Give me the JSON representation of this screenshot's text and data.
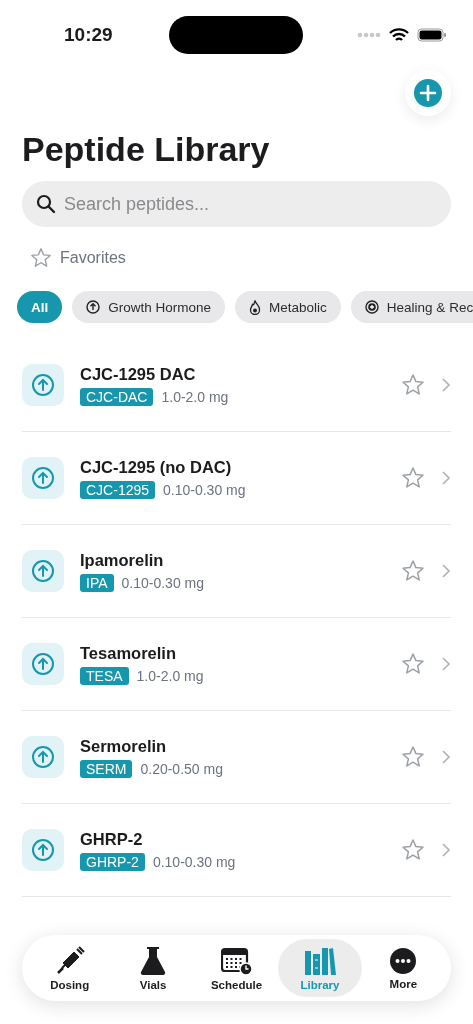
{
  "status_bar": {
    "time": "10:29"
  },
  "title": "Peptide Library",
  "search": {
    "placeholder": "Search peptides..."
  },
  "favorites": {
    "label": "Favorites",
    "selected": false
  },
  "filters": [
    {
      "label": "All",
      "kind": "plain",
      "selected": true
    },
    {
      "label": "Growth Hormone",
      "kind": "arrow",
      "selected": false
    },
    {
      "label": "Metabolic",
      "kind": "flame",
      "selected": false
    },
    {
      "label": "Healing & Rec",
      "kind": "plus",
      "selected": false
    }
  ],
  "peptides": [
    {
      "name": "CJC-1295 DAC",
      "code": "CJC-DAC",
      "dose": "1.0-2.0 mg",
      "favorite": false
    },
    {
      "name": "CJC-1295 (no DAC)",
      "code": "CJC-1295",
      "dose": "0.10-0.30 mg",
      "favorite": false
    },
    {
      "name": "Ipamorelin",
      "code": "IPA",
      "dose": "0.10-0.30 mg",
      "favorite": false
    },
    {
      "name": "Tesamorelin",
      "code": "TESA",
      "dose": "1.0-2.0 mg",
      "favorite": false
    },
    {
      "name": "Sermorelin",
      "code": "SERM",
      "dose": "0.20-0.50 mg",
      "favorite": false
    },
    {
      "name": "GHRP-2",
      "code": "GHRP-2",
      "dose": "0.10-0.30 mg",
      "favorite": false
    }
  ],
  "tabs": [
    {
      "label": "Dosing",
      "kind": "syringe",
      "selected": false
    },
    {
      "label": "Vials",
      "kind": "flask",
      "selected": false
    },
    {
      "label": "Schedule",
      "kind": "calendar",
      "selected": false
    },
    {
      "label": "Library",
      "kind": "books",
      "selected": true
    },
    {
      "label": "More",
      "kind": "more",
      "selected": false
    }
  ]
}
